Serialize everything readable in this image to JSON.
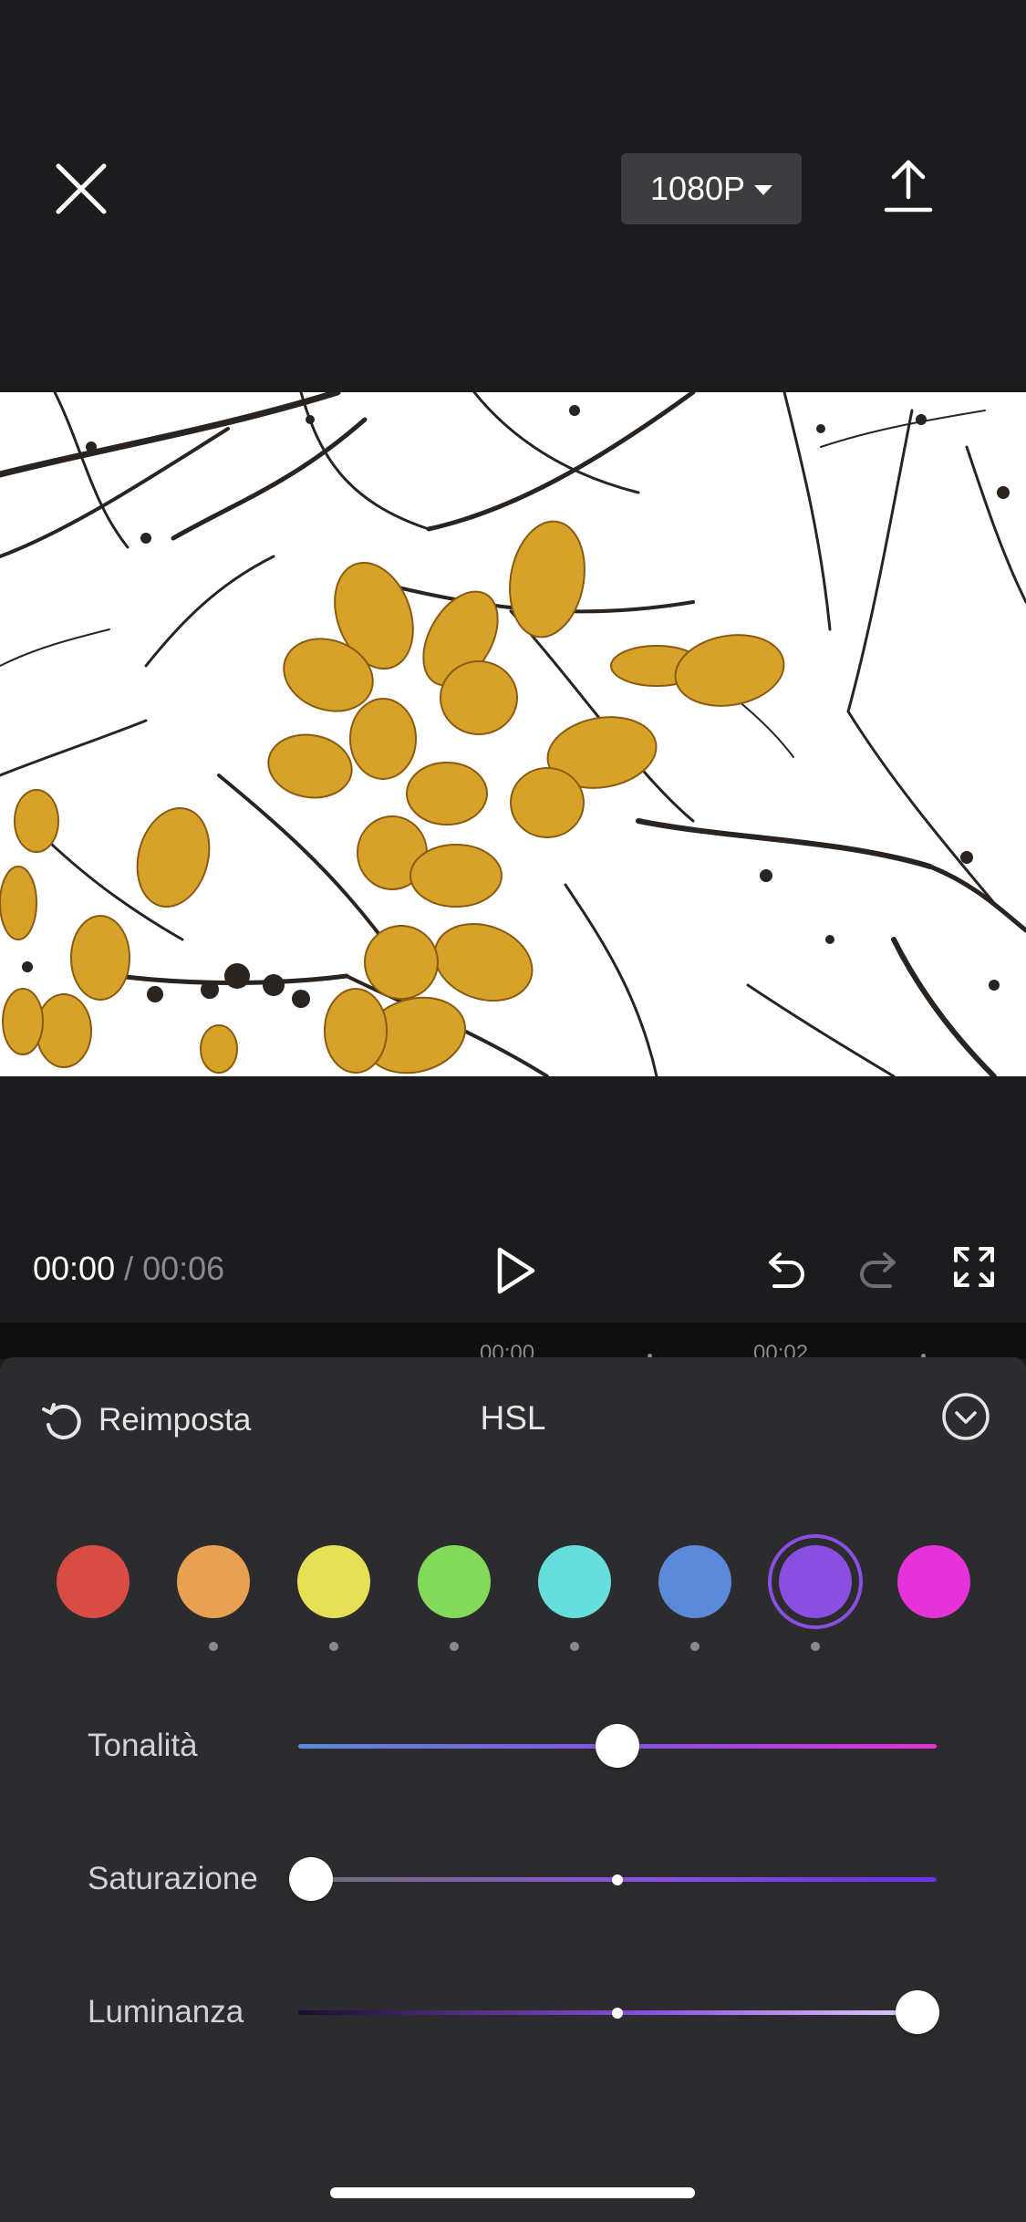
{
  "header": {
    "resolution": "1080P",
    "icons": {
      "close": "close-icon",
      "export": "upload-icon",
      "caret": "caret-down-icon"
    }
  },
  "playback": {
    "current_time": "00:00",
    "separator": "/",
    "duration": "00:06",
    "icons": {
      "play": "play-icon",
      "undo": "undo-icon",
      "redo": "redo-icon",
      "fullscreen": "fullscreen-icon"
    }
  },
  "timeline": {
    "ticks": [
      "00:00",
      "00:02"
    ]
  },
  "panel": {
    "reset_label": "Reimposta",
    "title": "HSL",
    "icons": {
      "reset": "reset-icon",
      "collapse": "chevron-down-circle-icon"
    },
    "colors": [
      {
        "hex": "#d94c43",
        "selected": false,
        "has_dot": false
      },
      {
        "hex": "#e8a052",
        "selected": false,
        "has_dot": true
      },
      {
        "hex": "#e5e056",
        "selected": false,
        "has_dot": true
      },
      {
        "hex": "#82d95a",
        "selected": false,
        "has_dot": true
      },
      {
        "hex": "#66dedb",
        "selected": false,
        "has_dot": true
      },
      {
        "hex": "#5b8ad8",
        "selected": false,
        "has_dot": true
      },
      {
        "hex": "#8a4fe0",
        "selected": true,
        "has_dot": true
      },
      {
        "hex": "#e632d9",
        "selected": false,
        "has_dot": false
      }
    ],
    "sliders": [
      {
        "label": "Tonalità",
        "value": 0.5
      },
      {
        "label": "Saturazione",
        "value": 0.02
      },
      {
        "label": "Luminanza",
        "value": 0.97
      }
    ]
  }
}
